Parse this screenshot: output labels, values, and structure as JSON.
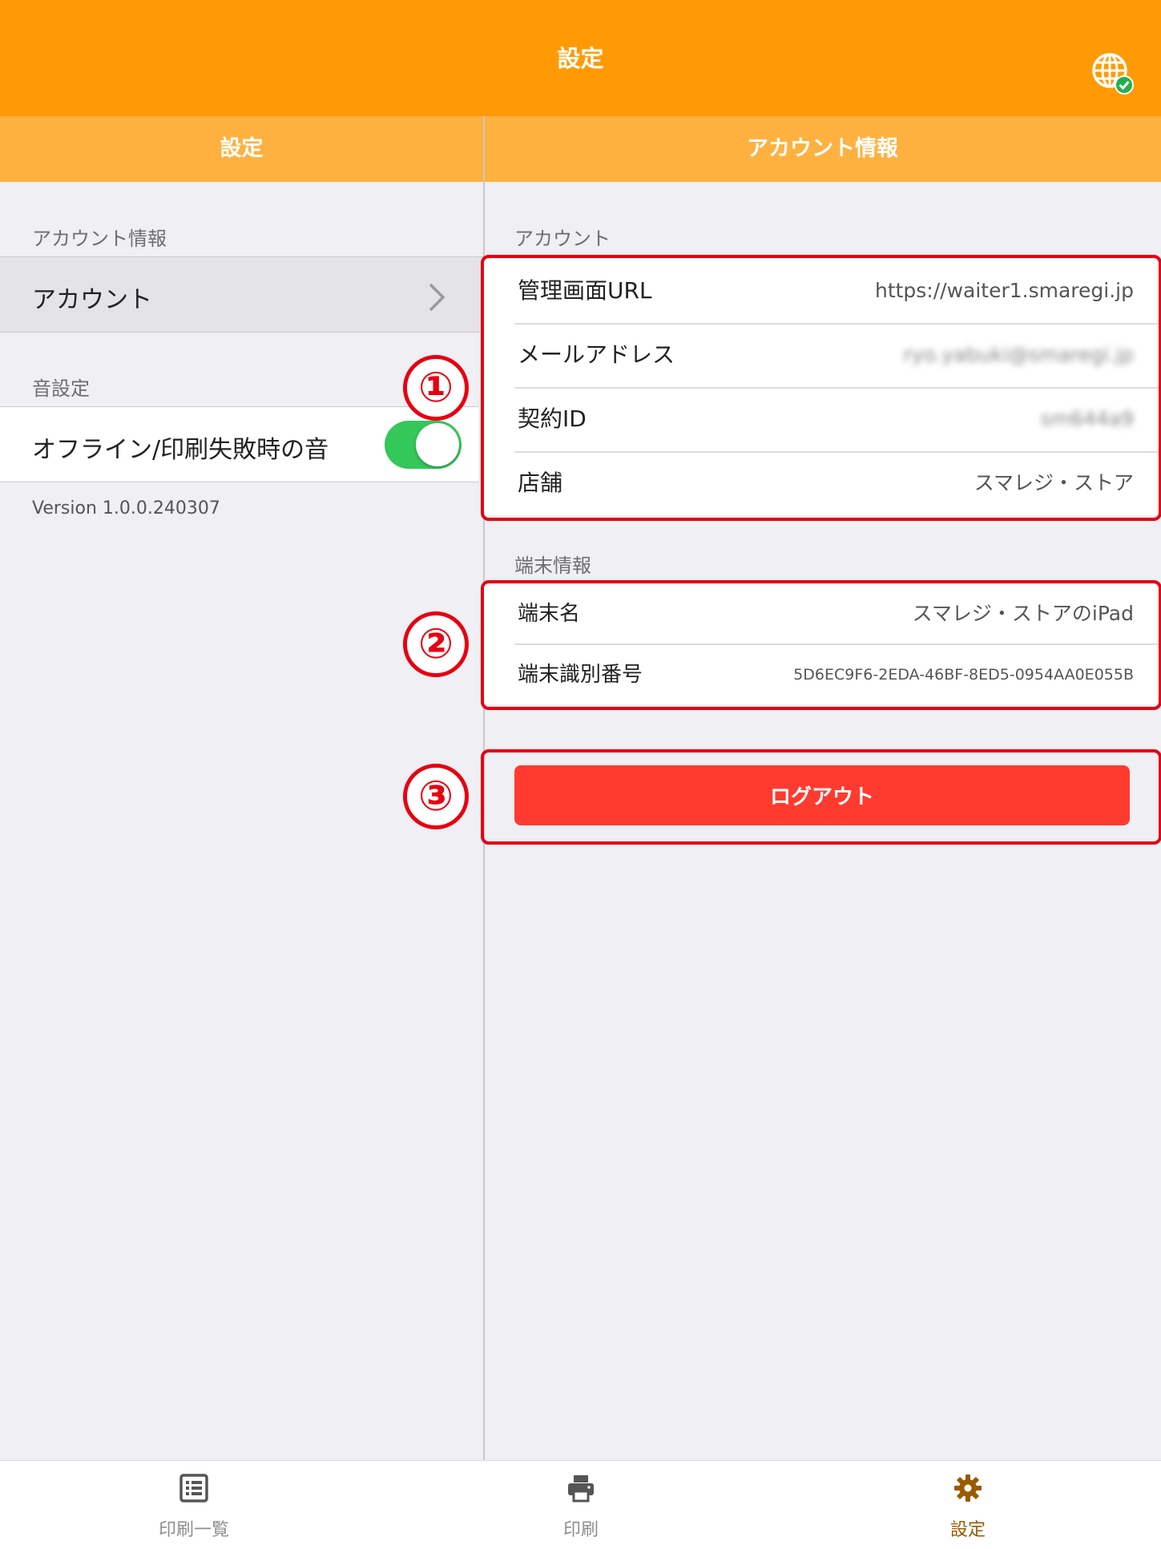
{
  "header": {
    "title": "設定"
  },
  "left_panel": {
    "title": "設定",
    "section_account": "アカウント情報",
    "account_item": "アカウント",
    "section_sound": "音設定",
    "sound_item": "オフライン/印刷失敗時の音",
    "sound_toggle_on": true,
    "version": "Version 1.0.0.240307"
  },
  "right_panel": {
    "title": "アカウント情報",
    "section_account": "アカウント",
    "account_rows": [
      {
        "label": "管理画面URL",
        "value": "https://waiter1.smaregi.jp"
      },
      {
        "label": "メールアドレス",
        "value": "ryo.yabuki@smaregi.jp"
      },
      {
        "label": "契約ID",
        "value": "sm644a9"
      },
      {
        "label": "店舗",
        "value": "スマレジ・ストア"
      }
    ],
    "section_device": "端末情報",
    "device_rows": [
      {
        "label": "端末名",
        "value": "スマレジ・ストアのiPad"
      },
      {
        "label": "端末識別番号",
        "value": "5D6EC9F6-2EDA-46BF-8ED5-0954AA0E055B"
      }
    ],
    "logout_label": "ログアウト"
  },
  "annotations": {
    "one": "①",
    "two": "②",
    "three": "③"
  },
  "tabbar": {
    "items": [
      {
        "label": "印刷一覧",
        "icon": "list-icon"
      },
      {
        "label": "印刷",
        "icon": "printer-icon"
      },
      {
        "label": "設定",
        "icon": "gear-icon"
      }
    ]
  },
  "colors": {
    "header": "#ff9a05",
    "subheader": "#ffb140",
    "logout": "#ff3b30",
    "annotation": "#e60012",
    "toggle": "#34c759",
    "active_tab": "#9a5a00"
  }
}
